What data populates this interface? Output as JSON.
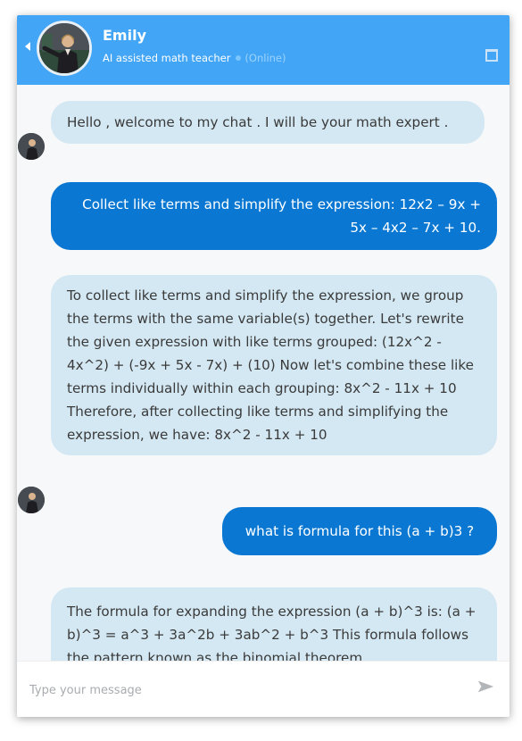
{
  "header": {
    "name": "Emily",
    "role": "AI assisted math teacher",
    "status": "(Online)",
    "back_icon": "back-arrow-icon",
    "expand_icon": "expand-window-icon"
  },
  "messages": [
    {
      "sender": "bot",
      "text": "Hello , welcome to my chat . I will be your math expert ."
    },
    {
      "sender": "user",
      "text": "Collect like terms and simplify the expression: 12x2 – 9x + 5x – 4x2 – 7x + 10."
    },
    {
      "sender": "bot",
      "text": "To collect like terms and simplify the expression, we group the terms with the same variable(s) together. Let's rewrite the given expression with like terms grouped: (12x^2 - 4x^2) + (-9x + 5x - 7x) + (10) Now let's combine these like terms individually within each grouping: 8x^2 - 11x + 10 Therefore, after collecting like terms and simplifying the expression, we have: 8x^2 - 11x + 10"
    },
    {
      "sender": "user",
      "text": "what is formula for this (a + b)3 ?"
    },
    {
      "sender": "bot",
      "text": "The formula for expanding the expression (a + b)^3 is: (a + b)^3 = a^3 + 3a^2b + 3ab^2 + b^3 This formula follows the pattern known as the binomial theorem,"
    }
  ],
  "composer": {
    "placeholder": "Type your message",
    "send_icon": "send-icon"
  },
  "colors": {
    "header": "#42a5f5",
    "bot_bubble": "#d4e8f3",
    "user_bubble": "#0a78d2"
  }
}
